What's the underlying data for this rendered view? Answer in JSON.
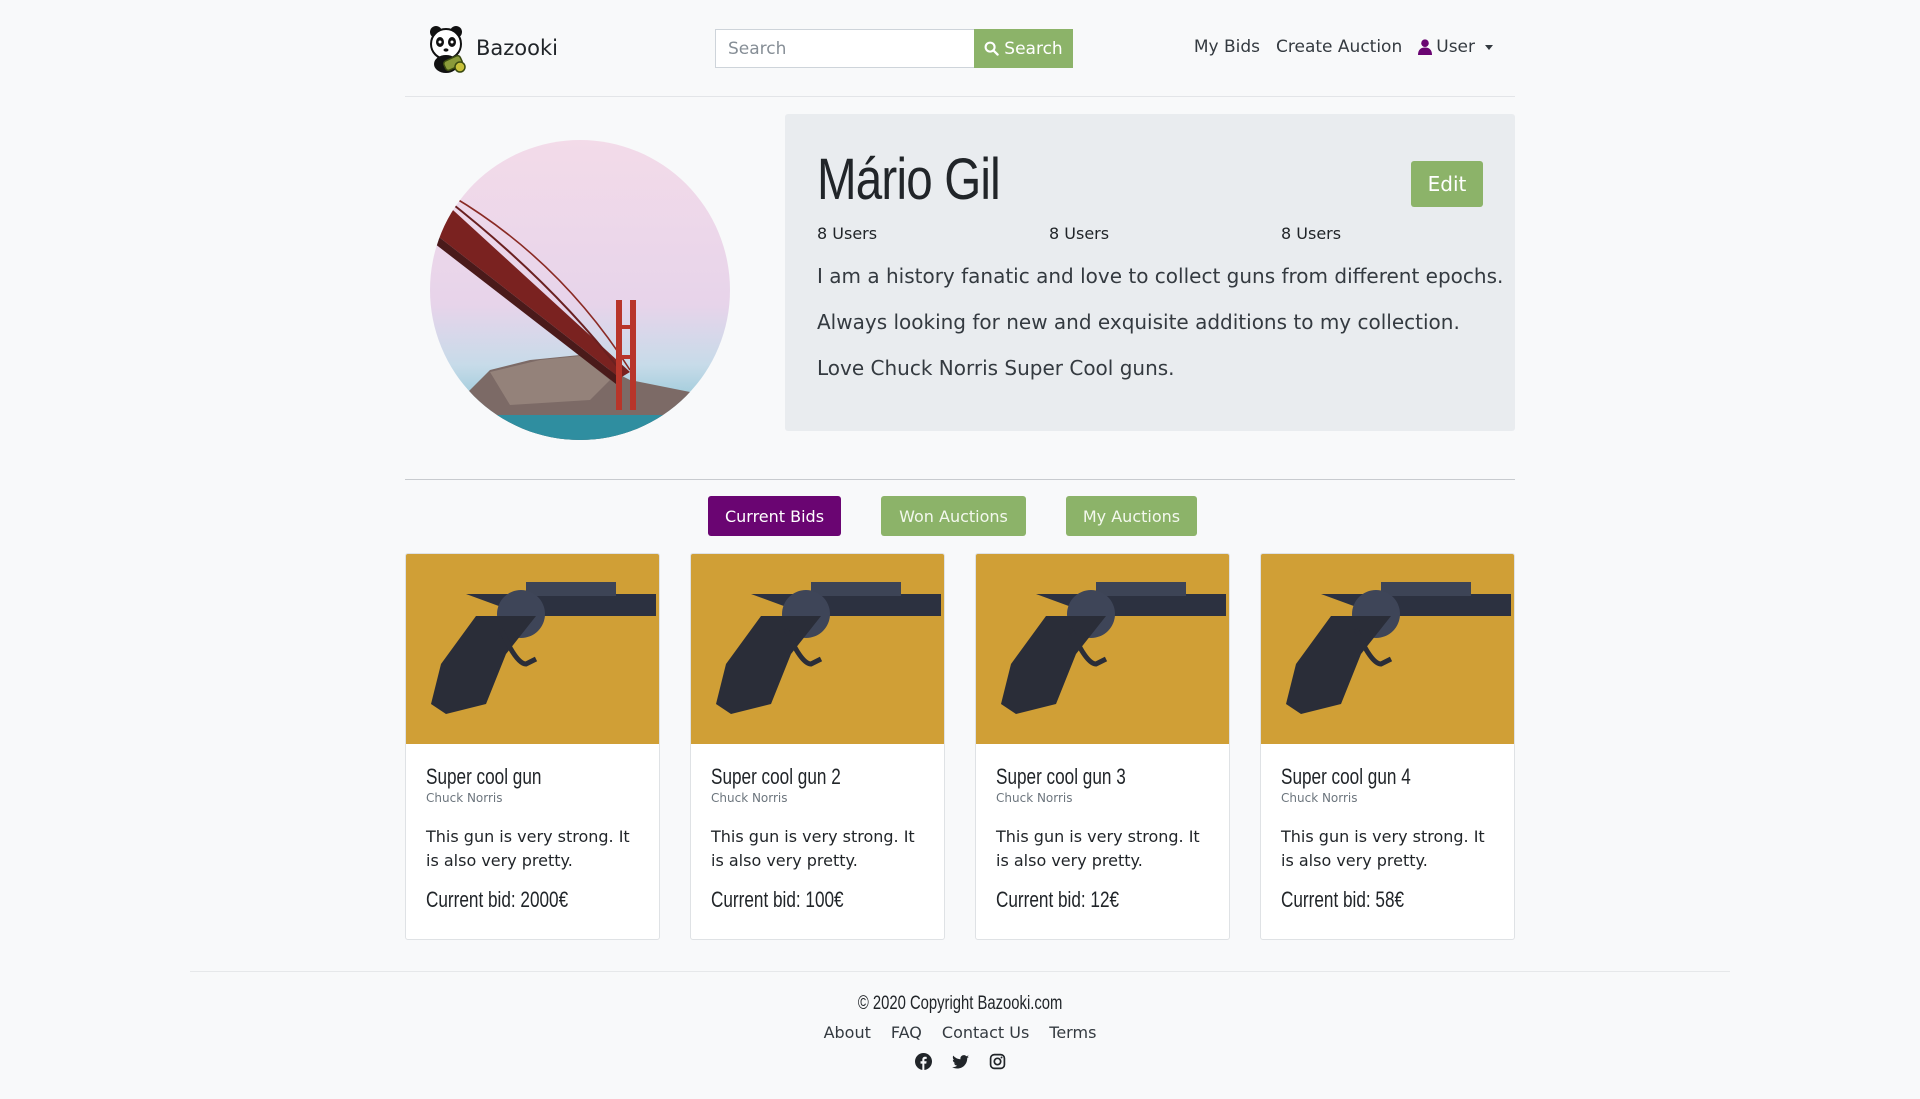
{
  "navbar": {
    "brand": "Bazooki",
    "search_placeholder": "Search",
    "search_button": "Search",
    "links": [
      "My Bids",
      "Create Auction"
    ],
    "user_label": "User"
  },
  "profile": {
    "name": "Mário Gil",
    "edit_label": "Edit",
    "stats": [
      "8 Users",
      "8 Users",
      "8 Users"
    ],
    "bio": [
      "I am a history fanatic and love to collect guns from different epochs.",
      "Always looking for new and exquisite additions to my collection.",
      "Love Chuck Norris Super Cool guns."
    ]
  },
  "tabs": [
    {
      "label": "Current Bids",
      "active": true
    },
    {
      "label": "Won Auctions",
      "active": false
    },
    {
      "label": "My Auctions",
      "active": false
    }
  ],
  "cards": [
    {
      "title": "Super cool gun",
      "seller": "Chuck Norris",
      "description": "This gun is very strong. It is also very pretty.",
      "bid": "Current bid: 2000€"
    },
    {
      "title": "Super cool gun 2",
      "seller": "Chuck Norris",
      "description": "This gun is very strong. It is also very pretty.",
      "bid": "Current bid: 100€"
    },
    {
      "title": "Super cool gun 3",
      "seller": "Chuck Norris",
      "description": "This gun is very strong. It is also very pretty.",
      "bid": "Current bid: 12€"
    },
    {
      "title": "Super cool gun 4",
      "seller": "Chuck Norris",
      "description": "This gun is very strong. It is also very pretty.",
      "bid": "Current bid: 58€"
    }
  ],
  "footer": {
    "copyright": "© 2020 Copyright Bazooki.com",
    "links": [
      "About",
      "FAQ",
      "Contact Us",
      "Terms"
    ],
    "social_icons": [
      "facebook-icon",
      "twitter-icon",
      "instagram-icon"
    ]
  },
  "colors": {
    "accent_green": "#8cb369",
    "accent_purple": "#6a0572",
    "user_icon": "#6a0572",
    "card_bg": "#e9ecef"
  }
}
